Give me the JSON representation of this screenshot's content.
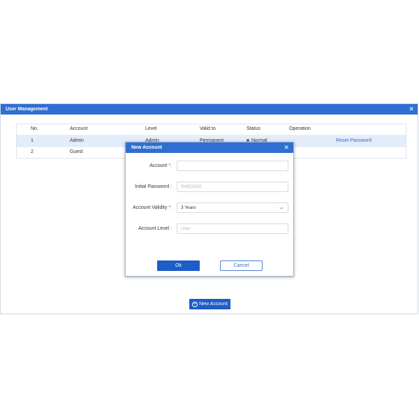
{
  "window": {
    "title": "User Management"
  },
  "table": {
    "headers": {
      "no": "No.",
      "account": "Account",
      "level": "Level",
      "valid_to": "Valid to",
      "status": "Status",
      "operation": "Operation"
    },
    "rows": [
      {
        "no": "1",
        "account": "Admin",
        "level": "Admin",
        "valid_to": "Permanent",
        "status": "Normal",
        "operation": "Reset Password"
      },
      {
        "no": "2",
        "account": "Guest",
        "level": "",
        "valid_to": "",
        "status": "",
        "operation": ""
      }
    ]
  },
  "new_account_button": {
    "label": "New Account"
  },
  "dialog": {
    "title": "New Account",
    "fields": {
      "account": {
        "label": "Account",
        "required_mark": "*:",
        "value": ""
      },
      "initial_password": {
        "label": "Initial Password :",
        "value": "RWD2002"
      },
      "account_validity": {
        "label": "Account Validity",
        "required_mark": "*:",
        "value": "3 Years"
      },
      "account_level": {
        "label": "Account Level :",
        "placeholder": "User"
      }
    },
    "ok_label": "Ok",
    "cancel_label": "Cancel"
  },
  "icons": {
    "close": "close-icon",
    "plus": "plus-circle-icon",
    "chevron": "chevron-down-icon"
  },
  "colors": {
    "accent": "#2f6fd1",
    "button": "#1e5cc7",
    "selected_row": "#e3ecfa",
    "required": "#e04848"
  }
}
